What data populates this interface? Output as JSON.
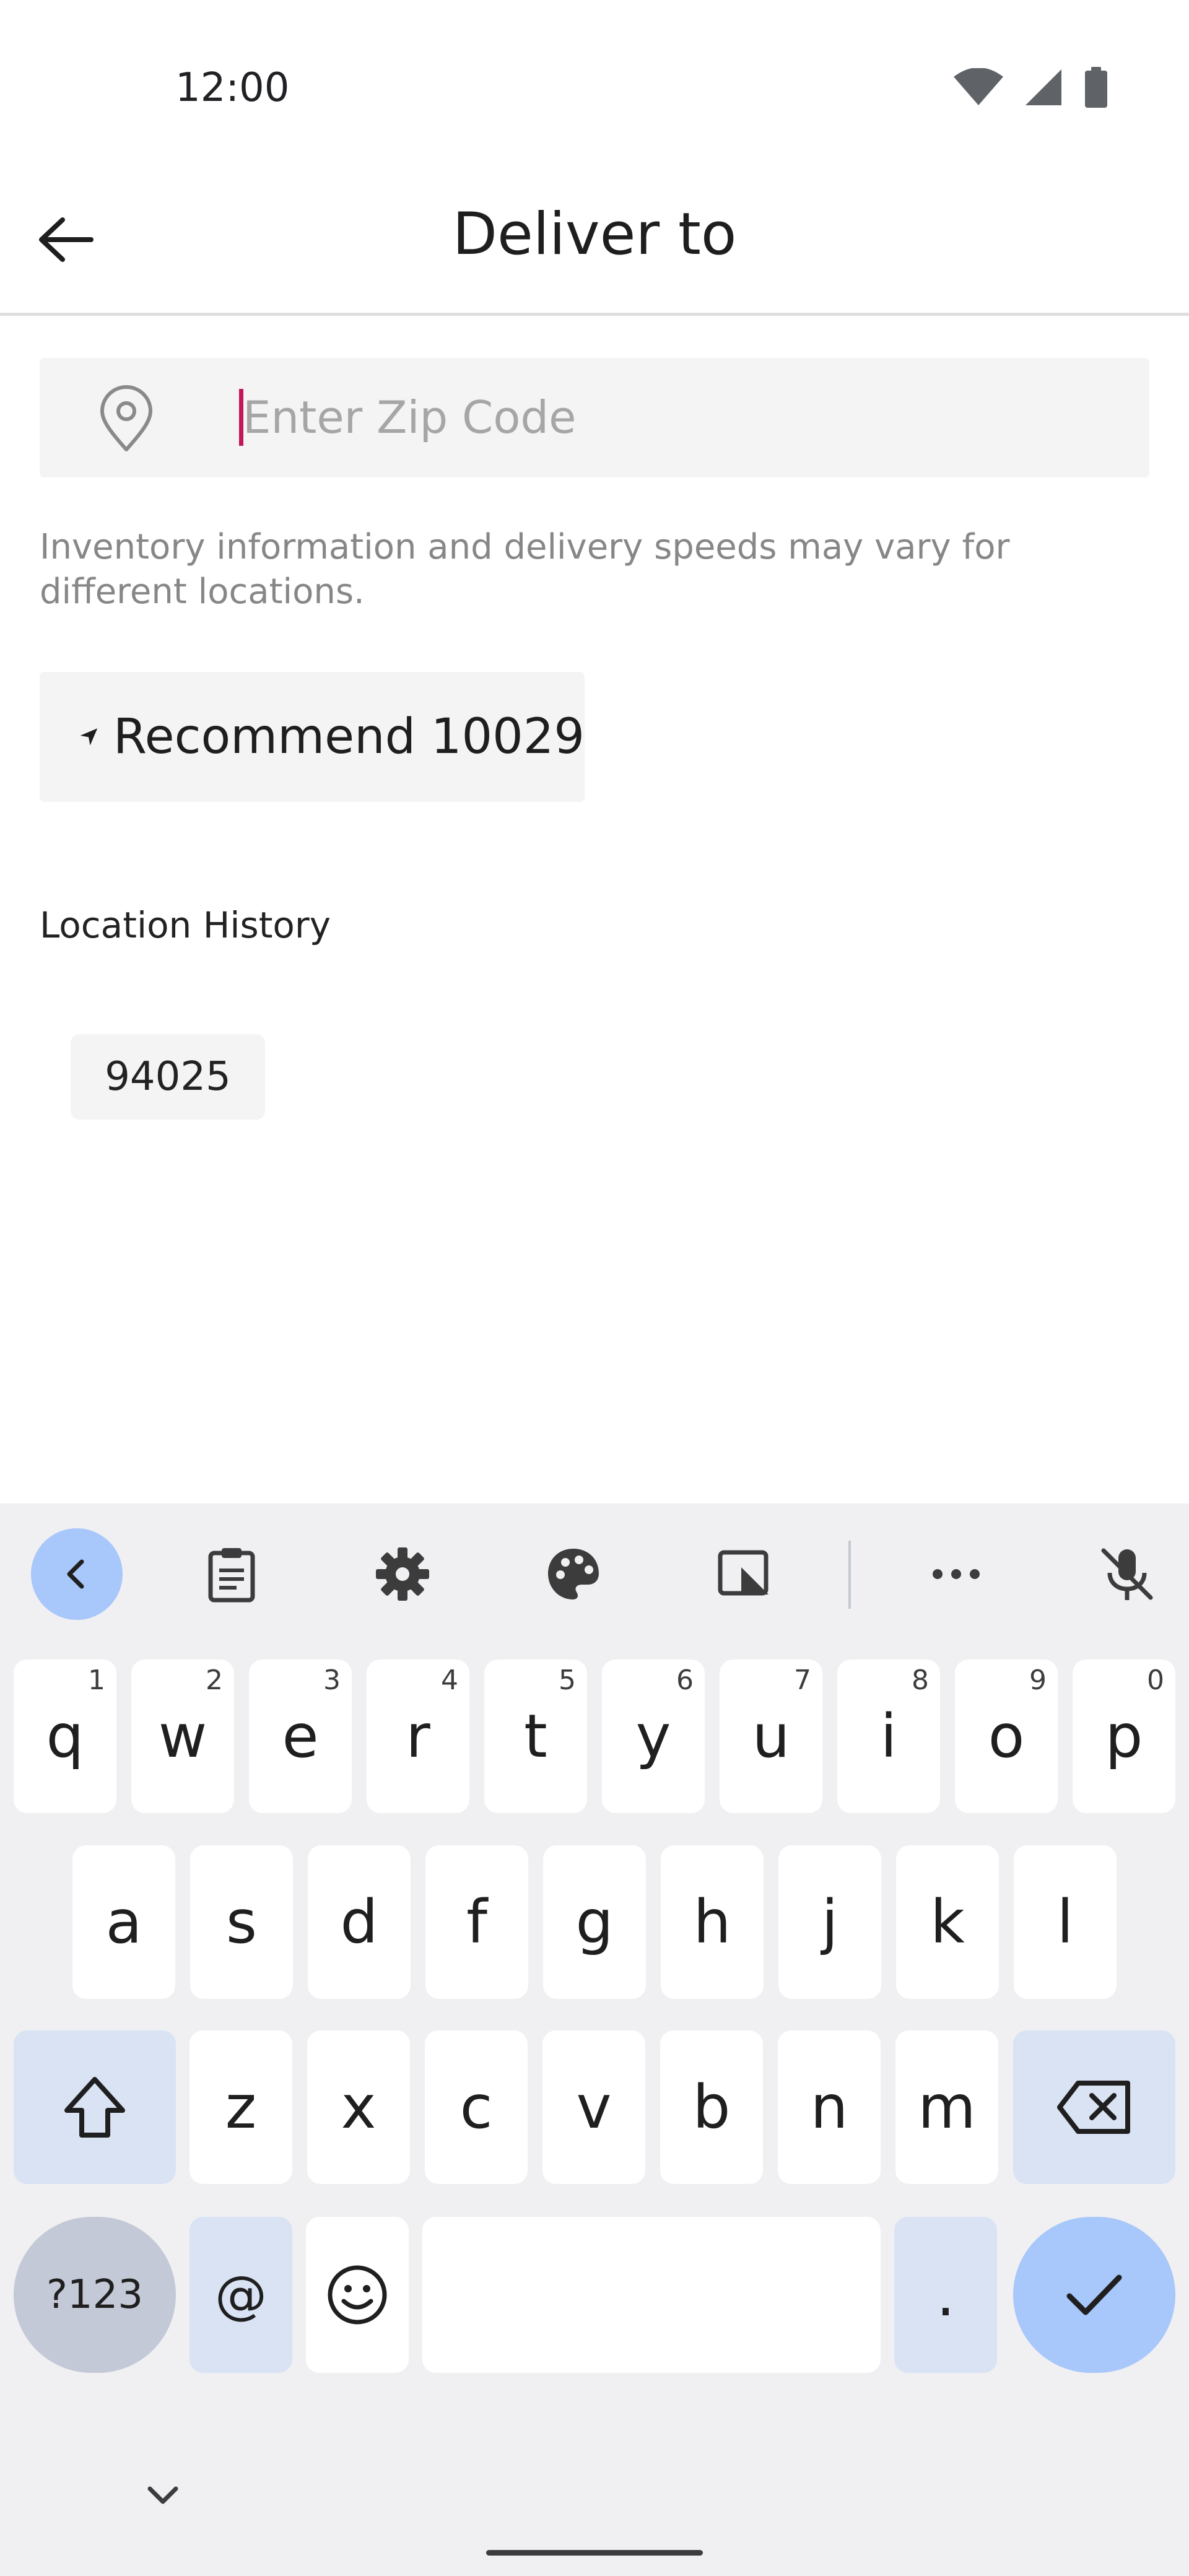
{
  "status": {
    "time": "12:00",
    "icons": [
      "wifi-icon",
      "cellular-signal-icon",
      "battery-icon"
    ]
  },
  "header": {
    "back_icon": "arrow-left-icon",
    "title": "Deliver to"
  },
  "zip": {
    "icon": "location-pin-icon",
    "placeholder": "Enter Zip Code",
    "value": ""
  },
  "info_text": "Inventory information and delivery speeds may vary for different locations.",
  "recommend": {
    "icon": "navigation-arrow-icon",
    "label": "Recommend 10029"
  },
  "history": {
    "heading": "Location History",
    "items": [
      "94025"
    ]
  },
  "keyboard": {
    "toolbar": [
      "collapse-chevron-icon",
      "clipboard-icon",
      "settings-gear-icon",
      "palette-icon",
      "floating-keyboard-icon",
      "more-dots-icon",
      "mic-off-icon"
    ],
    "row1": [
      {
        "key": "q",
        "hint": "1"
      },
      {
        "key": "w",
        "hint": "2"
      },
      {
        "key": "e",
        "hint": "3"
      },
      {
        "key": "r",
        "hint": "4"
      },
      {
        "key": "t",
        "hint": "5"
      },
      {
        "key": "y",
        "hint": "6"
      },
      {
        "key": "u",
        "hint": "7"
      },
      {
        "key": "i",
        "hint": "8"
      },
      {
        "key": "o",
        "hint": "9"
      },
      {
        "key": "p",
        "hint": "0"
      }
    ],
    "row2": [
      "a",
      "s",
      "d",
      "f",
      "g",
      "h",
      "j",
      "k",
      "l"
    ],
    "row3": [
      "z",
      "x",
      "c",
      "v",
      "b",
      "n",
      "m"
    ],
    "symbols_label": "?123",
    "at_label": "@",
    "period_label": "."
  },
  "colors": {
    "accent_caret": "#c2185b",
    "keyboard_accent": "#a8c7fa",
    "keyboard_mod": "#d9e3f4"
  }
}
